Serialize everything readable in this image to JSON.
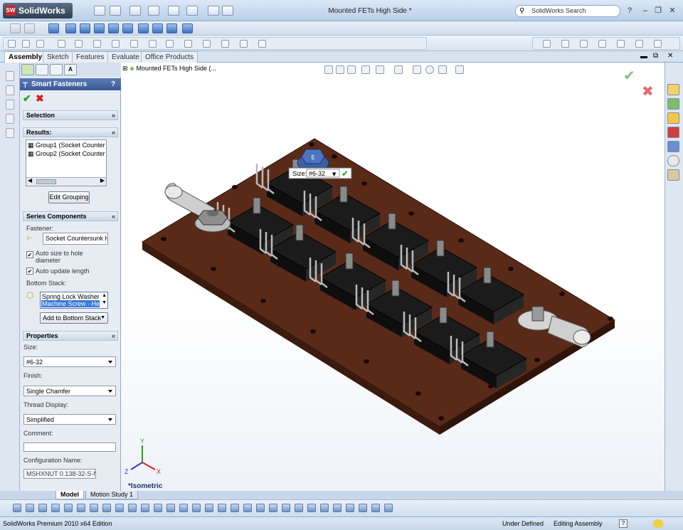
{
  "app": {
    "name": "SolidWorks",
    "document_title": "Mounted FETs High Side *",
    "search_placeholder": "SolidWorks Search"
  },
  "command_tabs": [
    "Assembly",
    "Sketch",
    "Features",
    "Evaluate",
    "Office Products"
  ],
  "tree": {
    "root_label": "Mounted FETs High Side  (..."
  },
  "property_manager": {
    "title": "Smart Fasteners",
    "help": "?",
    "selection": {
      "header": "Selection"
    },
    "results": {
      "header": "Results:",
      "items": [
        "Group1 (Socket Counter",
        "Group2 (Socket Counter"
      ],
      "edit_grouping": "Edit Grouping"
    },
    "series": {
      "header": "Series Components",
      "fastener_label": "Fastener:",
      "fastener_value": "Socket Countersunk H",
      "auto_size": "Auto size to hole diameter",
      "auto_update": "Auto update length",
      "bottom_stack_label": "Bottom Stack:",
      "stack_items": [
        "Spring Lock Washer",
        "Machine Screw - He"
      ],
      "add_bottom": "Add to Bottom Stack"
    },
    "properties": {
      "header": "Properties",
      "size_label": "Size:",
      "size_value": "#6-32",
      "finish_label": "Finish:",
      "finish_value": "Single Chamfer",
      "thread_label": "Thread Display:",
      "thread_value": "Simplified",
      "comment_label": "Comment:",
      "comment_value": "",
      "config_label": "Configuration Name:",
      "config_value": "MSHXNUT 0.138-32-S-N"
    }
  },
  "viewport": {
    "size_popup_label": "Size:",
    "size_popup_value": "#6-32",
    "view_name": "*Isometric",
    "axis": {
      "x": "X",
      "y": "Y",
      "z": "Z"
    }
  },
  "bottom_tabs": [
    "Model",
    "Motion Study 1"
  ],
  "status": {
    "left": "SolidWorks Premium 2010 x64 Edition",
    "state": "Under Defined",
    "mode": "Editing Assembly"
  },
  "colors": {
    "board": "#5a2a18",
    "fet": "#141414",
    "accent": "#3a5a98",
    "accept": "#22a022",
    "cancel": "#d42020"
  }
}
